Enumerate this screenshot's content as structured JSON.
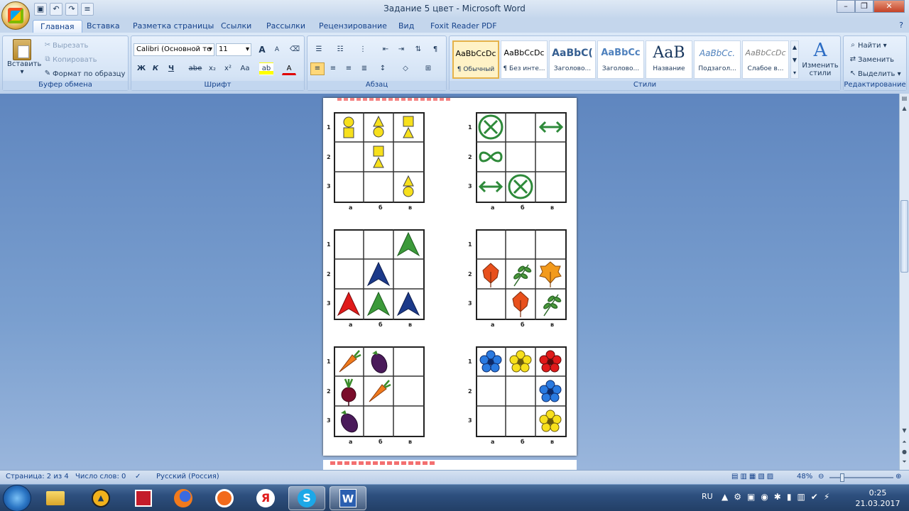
{
  "window": {
    "title": "Задание 5 цвет - Microsoft Word"
  },
  "tabs": [
    "Главная",
    "Вставка",
    "Разметка страницы",
    "Ссылки",
    "Рассылки",
    "Рецензирование",
    "Вид",
    "Foxit Reader PDF"
  ],
  "clipboard": {
    "paste": "Вставить",
    "cut": "Вырезать",
    "copy": "Копировать",
    "format_painter": "Формат по образцу",
    "label": "Буфер обмена"
  },
  "font": {
    "name": "Calibri (Основной те",
    "size": "11",
    "label": "Шрифт",
    "bold": "Ж",
    "italic": "К",
    "underline": "Ч",
    "strike": "abe",
    "sub": "x₂",
    "sup": "x²",
    "case": "Aa",
    "grow": "A",
    "shrink": "A"
  },
  "paragraph": {
    "label": "Абзац"
  },
  "styles": {
    "label": "Стили",
    "items": [
      {
        "preview": "AaBbCcDc",
        "name": "¶ Обычный"
      },
      {
        "preview": "AaBbCcDc",
        "name": "¶ Без инте..."
      },
      {
        "preview": "AaBbC(",
        "name": "Заголово..."
      },
      {
        "preview": "AaBbCc",
        "name": "Заголово..."
      },
      {
        "preview": "AaB",
        "name": "Название"
      },
      {
        "preview": "AaBbCc.",
        "name": "Подзагол..."
      },
      {
        "preview": "AaBbCcDc",
        "name": "Слабое в..."
      }
    ],
    "change": "Изменить стили"
  },
  "editing": {
    "label": "Редактирование",
    "find": "Найти",
    "replace": "Заменить",
    "select": "Выделить"
  },
  "puzzle": {
    "rows": [
      "1",
      "2",
      "3"
    ],
    "cols": [
      "а",
      "б",
      "в"
    ]
  },
  "status": {
    "page": "Страница: 2 из 4",
    "words": "Число слов: 0",
    "lang": "Русский (Россия)",
    "zoom": "48%"
  },
  "taskbar": {
    "lang": "RU",
    "time": "0:25",
    "date": "21.03.2017"
  }
}
